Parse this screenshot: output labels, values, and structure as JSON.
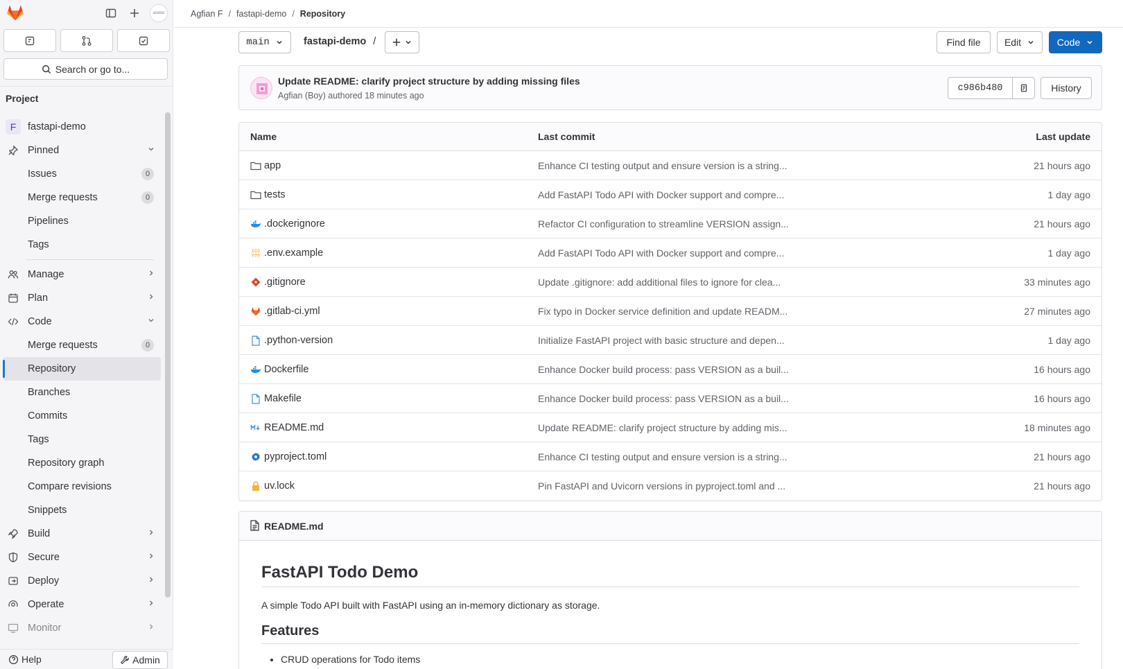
{
  "breadcrumb": [
    "Agfian F",
    "fastapi-demo",
    "Repository"
  ],
  "sidebar": {
    "search_label": "Search or go to...",
    "section_title": "Project",
    "project_name": "fastapi-demo",
    "project_initial": "F",
    "avatar_text": "avatar",
    "items": [
      {
        "label": "Pinned"
      },
      {
        "label": "Issues",
        "count": "0"
      },
      {
        "label": "Merge requests",
        "count": "0"
      },
      {
        "label": "Pipelines"
      },
      {
        "label": "Tags"
      },
      {
        "label": "Manage"
      },
      {
        "label": "Plan"
      },
      {
        "label": "Code"
      },
      {
        "label": "Merge requests",
        "count": "0"
      },
      {
        "label": "Repository"
      },
      {
        "label": "Branches"
      },
      {
        "label": "Commits"
      },
      {
        "label": "Tags"
      },
      {
        "label": "Repository graph"
      },
      {
        "label": "Compare revisions"
      },
      {
        "label": "Snippets"
      },
      {
        "label": "Build"
      },
      {
        "label": "Secure"
      },
      {
        "label": "Deploy"
      },
      {
        "label": "Operate"
      },
      {
        "label": "Monitor"
      }
    ],
    "help_label": "Help",
    "admin_label": "Admin"
  },
  "toolbar": {
    "branch": "main",
    "repo_path": "fastapi-demo",
    "path_sep": "/",
    "find_file": "Find file",
    "edit": "Edit",
    "code": "Code"
  },
  "last_commit": {
    "title": "Update README: clarify project structure by adding missing files",
    "meta": "Agfian (Boy) authored 18 minutes ago",
    "sha": "c986b480",
    "history": "History"
  },
  "tree": {
    "headers": {
      "name": "Name",
      "commit": "Last commit",
      "update": "Last update"
    },
    "rows": [
      {
        "name": "app",
        "icon": "folder-icon",
        "commit": "Enhance CI testing output and ensure version is a string...",
        "date": "21 hours ago"
      },
      {
        "name": "tests",
        "icon": "folder-icon",
        "commit": "Add FastAPI Todo API with Docker support and compre...",
        "date": "1 day ago"
      },
      {
        "name": ".dockerignore",
        "icon": "docker-icon",
        "commit": "Refactor CI configuration to streamline VERSION assign...",
        "date": "21 hours ago"
      },
      {
        "name": ".env.example",
        "icon": "env-icon",
        "commit": "Add FastAPI Todo API with Docker support and compre...",
        "date": "1 day ago"
      },
      {
        "name": ".gitignore",
        "icon": "git-icon",
        "commit": "Update .gitignore: add additional files to ignore for clea...",
        "date": "33 minutes ago"
      },
      {
        "name": ".gitlab-ci.yml",
        "icon": "gitlab-icon",
        "commit": "Fix typo in Docker service definition and update READM...",
        "date": "27 minutes ago"
      },
      {
        "name": ".python-version",
        "icon": "file-icon",
        "commit": "Initialize FastAPI project with basic structure and depen...",
        "date": "1 day ago"
      },
      {
        "name": "Dockerfile",
        "icon": "docker-icon",
        "commit": "Enhance Docker build process: pass VERSION as a buil...",
        "date": "16 hours ago"
      },
      {
        "name": "Makefile",
        "icon": "file-icon",
        "commit": "Enhance Docker build process: pass VERSION as a buil...",
        "date": "16 hours ago"
      },
      {
        "name": "README.md",
        "icon": "markdown-icon",
        "commit": "Update README: clarify project structure by adding mis...",
        "date": "18 minutes ago"
      },
      {
        "name": "pyproject.toml",
        "icon": "gear-icon",
        "commit": "Enhance CI testing output and ensure version is a string...",
        "date": "21 hours ago"
      },
      {
        "name": "uv.lock",
        "icon": "lock-icon",
        "commit": "Pin FastAPI and Uvicorn versions in pyproject.toml and ...",
        "date": "21 hours ago"
      }
    ]
  },
  "readme": {
    "filename": "README.md",
    "title": "FastAPI Todo Demo",
    "intro": "A simple Todo API built with FastAPI using an in-memory dictionary as storage.",
    "features_heading": "Features",
    "features": [
      "CRUD operations for Todo items"
    ]
  },
  "colors": {
    "accent": "#1068bf",
    "active_bar": "#1f75cb",
    "gitlab_orange": "#e24329"
  }
}
